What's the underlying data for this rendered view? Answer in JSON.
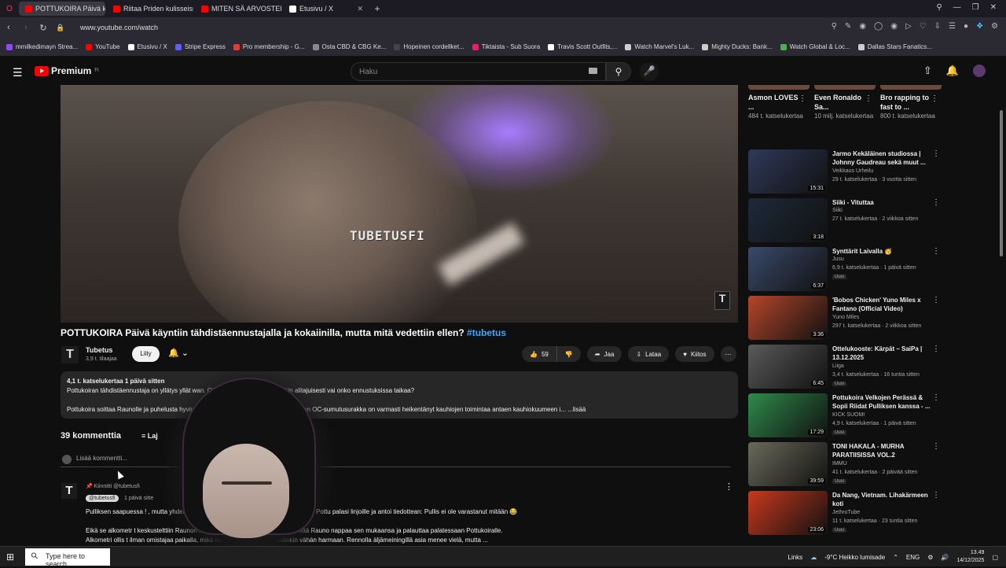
{
  "browser": {
    "tabs": [
      {
        "title": "POTTUKOIRA Päivä kä",
        "color": "#ff0000",
        "active": true
      },
      {
        "title": "Riitaa Priden kulisseissa |",
        "color": "#ff0000",
        "active": false
      },
      {
        "title": "MITEN SÄ ARVOSTELISIT!",
        "color": "#ff0000",
        "active": false
      },
      {
        "title": "Etusivu / X",
        "color": "#ffffff",
        "active": false
      }
    ],
    "new_tab": "+",
    "url": "www.youtube.com/watch",
    "bookmarks": [
      {
        "label": "mmilkedimayn Strea...",
        "color": "#9146ff"
      },
      {
        "label": "YouTube",
        "color": "#ff0000"
      },
      {
        "label": "Etusivu / X",
        "color": "#ffffff"
      },
      {
        "label": "Stripe Express",
        "color": "#635bff"
      },
      {
        "label": "Pro membership - G...",
        "color": "#e53935"
      },
      {
        "label": "Osta CBD & CBG Ke...",
        "color": "#888888"
      },
      {
        "label": "Hopeinen cordellket...",
        "color": "#444444"
      },
      {
        "label": "Tiktaista - Sub Suora",
        "color": "#e91e63"
      },
      {
        "label": "Travis Scott Outfits,...",
        "color": "#ffffff"
      },
      {
        "label": "Watch Marvel's Luk...",
        "color": "#cccccc"
      },
      {
        "label": "Mighty Ducks: Bank...",
        "color": "#cccccc"
      },
      {
        "label": "Watch Global & Loc...",
        "color": "#4caf50"
      },
      {
        "label": "Dallas Stars Fanatics...",
        "color": "#cccccc"
      }
    ]
  },
  "youtube": {
    "logo_text": "Premium",
    "logo_sup": "FI",
    "search_placeholder": "Haku",
    "video": {
      "watermark": "TUBETUSFI",
      "title": "POTTUKOIRA Päivä käyntiin tähdistäennustajalla ja kokaiinilla, mutta mitä vedettiin ellen?",
      "hashtag": "#tubetus",
      "channel": "Tubetus",
      "subscribers": "3,9 t. tilaajaa",
      "join_label": "Liity",
      "likes": "59",
      "share_label": "Jaa",
      "download_label": "Lataa",
      "thanks_label": "Kiitos",
      "description": {
        "meta": "4,1 t. katselukertaa  1 päivä sitten",
        "line1": "Pottukoiran tähdistäennustaja on yllätys yllät                                          wan. Ohjautuuko Pottukoira jotenkin alitajuisesti vai onko ennustuksissa taikaa?",
        "line2": "Pottukoira soittaa Raunolle ja puhelusta                                               hyvin. Raunolla on kauhiokuume ja Pottukoiran OC-sumutusurakka on varmasti heikentänyt kauhiojen toimintaa antaen kauhiokuumeen i... ...lisää"
      }
    },
    "comments": {
      "count_label": "39 kommenttia",
      "sort_label": "Laj",
      "add_placeholder": "Lisää kommentti...",
      "pinned_label": "Kiinnitti @tubetusfi",
      "author": "@tubetusfi",
      "time": "1 päivä sitte",
      "line1": "Pulliksen saapuessa !                                                      , mutta yhden tupakkareissun jälkeen ääni kallossa muuttui. Pottu palasi linjoille ja antoi tiedottean: Pullis ei ole varastanut mitään 😂",
      "line2": "Eikä se alkometr                                                             t keskustelttiin Raunon kanssa, ja ilmeisesti ajatuksena oli, että Rauno nappaa sen mukaansa ja palauttaa palatessaan Pottukoiralle.",
      "line3": "Alkometri ollis                                                              t ilman omistajaa paikalla, mikä tekee tilanteesta vähintäänkin vähän harmaan. Rennolla äljämeiningillä asia menee vielä, mutta ..."
    },
    "shorts": [
      {
        "title": "Asmon LOVES ...",
        "views": "484 t. katselukertaa"
      },
      {
        "title": "Even Ronaldo Sa...",
        "views": "10 milj. katselukertaa"
      },
      {
        "title": "Bro rapping to fast to ...",
        "views": "800 t. katselukertaa"
      }
    ],
    "recommendations": [
      {
        "title": "Jarmo Kekäläinen studiossa | Johnny Gaudreau sekä muut ...",
        "channel": "Veikkaus Urheilu",
        "views": "29 t. katselukertaa · 3 vuotta sitten",
        "duration": "15:31",
        "badge": "",
        "color": "#2e3a5a"
      },
      {
        "title": "Siiki - Vituttaa",
        "channel": "Siiki",
        "views": "27 t. katselukertaa · 2 viikkoa sitten",
        "duration": "3:18",
        "badge": "",
        "color": "#1d2a3a"
      },
      {
        "title": "Synttärit Laivalla 🥳",
        "channel": "Jusu",
        "views": "6,9 t. katselukertaa · 1 päivä sitten",
        "duration": "6:37",
        "badge": "Uusi",
        "color": "#3a4a6a"
      },
      {
        "title": "'Bobos Chicken' Yuno Miles x Fantano (Official Video)",
        "channel": "Yuno Miles",
        "views": "297 t. katselukertaa · 2 viikkoa sitten",
        "duration": "3:36",
        "badge": "",
        "color": "#b5462a"
      },
      {
        "title": "Ottelukooste: Kärpät – SaiPa | 13.12.2025",
        "channel": "Liiga",
        "views": "3,4 t. katselukertaa · 16 tuntia sitten",
        "duration": "6:45",
        "badge": "Uusi",
        "color": "#5a5a5a"
      },
      {
        "title": "Pottukoira Velkojen Perässä & Sopii Riidat Pulliksen kanssa - ...",
        "channel": "KICK SUOMI",
        "views": "4,9 t. katselukertaa · 1 päivä sitten",
        "duration": "17:29",
        "badge": "Uusi",
        "color": "#2f8a4a"
      },
      {
        "title": "TONI HAKALA - MURHA PARATIISISSA VOL.2",
        "channel": "IMMU",
        "views": "41 t. katselukertaa · 2 päivää sitten",
        "duration": "39:59",
        "badge": "Uusi",
        "color": "#6a6a5a"
      },
      {
        "title": "Da Nang, Vietnam. Lihakärmeen koti",
        "channel": "JethroTube",
        "views": "11 t. katselukertaa · 23 tuntia sitten",
        "duration": "23:06",
        "badge": "Uusi",
        "color": "#c9381e"
      }
    ]
  },
  "taskbar": {
    "search_placeholder": "Type here to search",
    "links_label": "Links",
    "weather": "-9°C  Heikko lumisade",
    "lang": "ENG",
    "time": "13.49",
    "date": "14/12/2025"
  }
}
